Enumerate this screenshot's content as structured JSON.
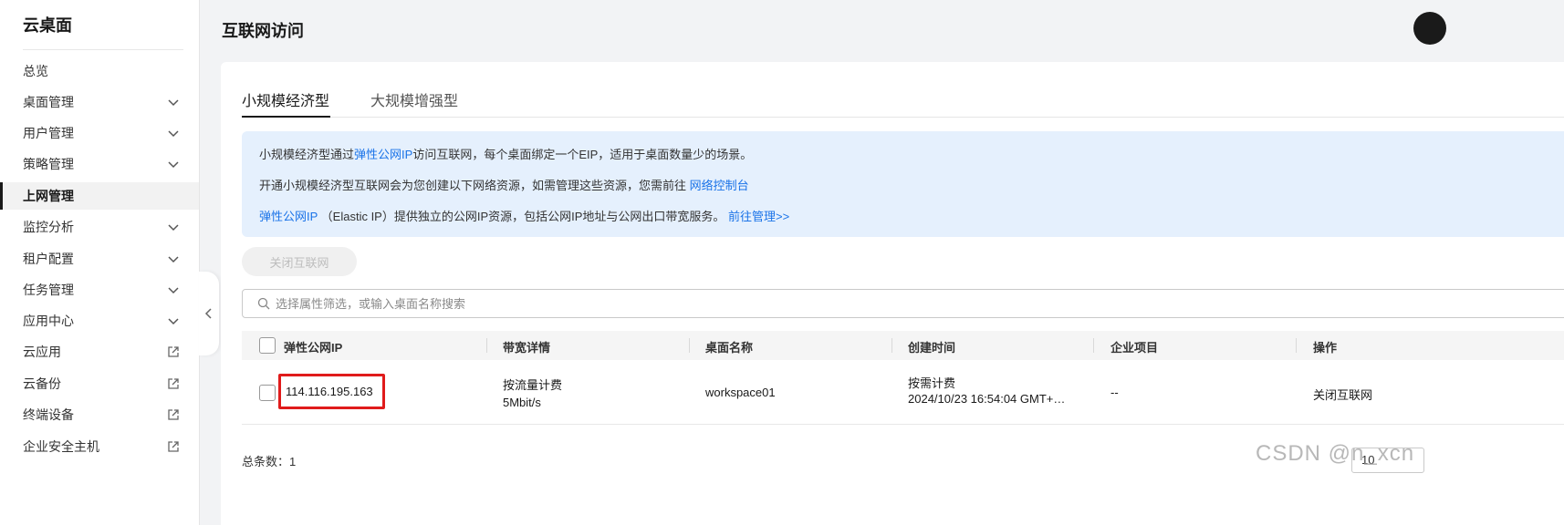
{
  "sidebar": {
    "title": "云桌面",
    "items": [
      {
        "label": "总览"
      },
      {
        "label": "桌面管理"
      },
      {
        "label": "用户管理"
      },
      {
        "label": "策略管理"
      },
      {
        "label": "上网管理"
      },
      {
        "label": "监控分析"
      },
      {
        "label": "租户配置"
      },
      {
        "label": "任务管理"
      },
      {
        "label": "应用中心"
      },
      {
        "label": "云应用"
      },
      {
        "label": "云备份"
      },
      {
        "label": "终端设备"
      },
      {
        "label": "企业安全主机"
      }
    ]
  },
  "header": {
    "title": "互联网访问"
  },
  "tabs": [
    {
      "label": "小规模经济型"
    },
    {
      "label": "大规模增强型"
    }
  ],
  "info": {
    "line1_pre": "小规模经济型通过",
    "line1_link": "弹性公网IP",
    "line1_post": "访问互联网，每个桌面绑定一个EIP，适用于桌面数量少的场景。",
    "line2_pre": "开通小规模经济型互联网会为您创建以下网络资源，如需管理这些资源，您需前往 ",
    "line2_link": "网络控制台",
    "line3_link": "弹性公网IP",
    "line3_mid": " （Elastic IP）提供独立的公网IP资源，包括公网IP地址与公网出口带宽服务。 ",
    "line3_link2": "前往管理>>"
  },
  "toolbar": {
    "close_internet": "关闭互联网"
  },
  "search": {
    "placeholder": "选择属性筛选，或输入桌面名称搜索"
  },
  "table": {
    "headers": [
      "弹性公网IP",
      "带宽详情",
      "桌面名称",
      "创建时间",
      "企业项目",
      "操作"
    ],
    "rows": [
      {
        "ip": "114.116.195.163",
        "bandwidth_type": "按流量计费",
        "bandwidth": "5Mbit/s",
        "desktop": "workspace01",
        "billing": "按需计费",
        "created": "2024/10/23 16:54:04 GMT+…",
        "project": "--",
        "action": "关闭互联网"
      }
    ]
  },
  "footer": {
    "total_label": "总条数：",
    "total_count": "1",
    "page_size": "10"
  },
  "watermark": "CSDN @n_xcn"
}
